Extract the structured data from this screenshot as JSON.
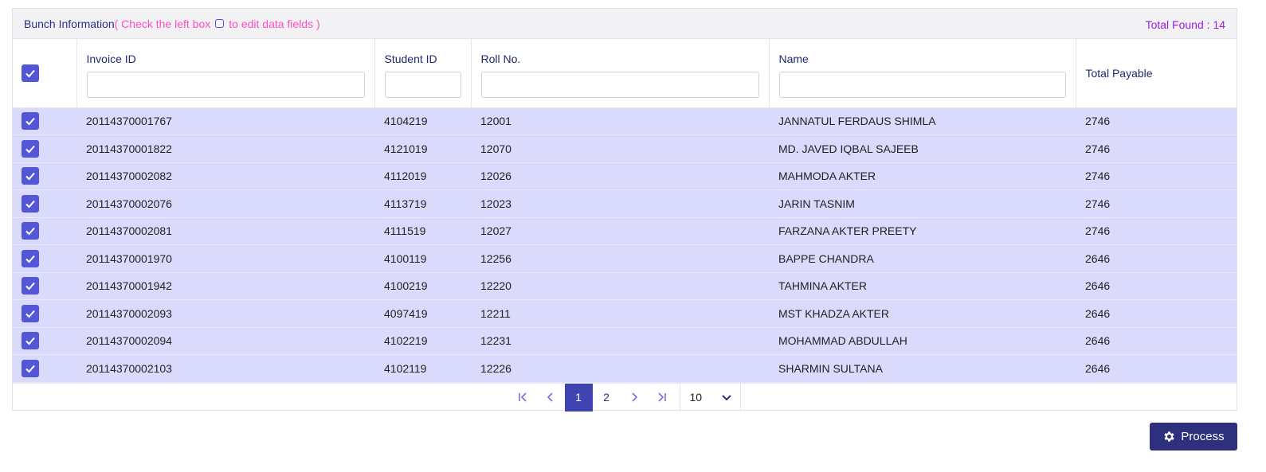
{
  "header": {
    "title": "Bunch Information",
    "hint_before": "( Check the left box",
    "hint_after": "to edit data fields )",
    "total_found": "Total Found : 14"
  },
  "columns": [
    "Invoice ID",
    "Student ID",
    "Roll No.",
    "Name",
    "Total Payable"
  ],
  "rows": [
    {
      "invoice_id": "20114370001767",
      "student_id": "4104219",
      "roll_no": "12001",
      "name": "JANNATUL FERDAUS SHIMLA",
      "total_payable": "2746",
      "checked": true
    },
    {
      "invoice_id": "20114370001822",
      "student_id": "4121019",
      "roll_no": "12070",
      "name": "MD. JAVED IQBAL SAJEEB",
      "total_payable": "2746",
      "checked": true
    },
    {
      "invoice_id": "20114370002082",
      "student_id": "4112019",
      "roll_no": "12026",
      "name": "MAHMODA AKTER",
      "total_payable": "2746",
      "checked": true
    },
    {
      "invoice_id": "20114370002076",
      "student_id": "4113719",
      "roll_no": "12023",
      "name": "JARIN TASNIM",
      "total_payable": "2746",
      "checked": true
    },
    {
      "invoice_id": "20114370002081",
      "student_id": "4111519",
      "roll_no": "12027",
      "name": "FARZANA AKTER PREETY",
      "total_payable": "2746",
      "checked": true
    },
    {
      "invoice_id": "20114370001970",
      "student_id": "4100119",
      "roll_no": "12256",
      "name": "BAPPE CHANDRA",
      "total_payable": "2646",
      "checked": true
    },
    {
      "invoice_id": "20114370001942",
      "student_id": "4100219",
      "roll_no": "12220",
      "name": "TAHMINA AKTER",
      "total_payable": "2646",
      "checked": true
    },
    {
      "invoice_id": "20114370002093",
      "student_id": "4097419",
      "roll_no": "12211",
      "name": "MST KHADZA AKTER",
      "total_payable": "2646",
      "checked": true
    },
    {
      "invoice_id": "20114370002094",
      "student_id": "4102219",
      "roll_no": "12231",
      "name": "MOHAMMAD ABDULLAH",
      "total_payable": "2646",
      "checked": true
    },
    {
      "invoice_id": "20114370002103",
      "student_id": "4102119",
      "roll_no": "12226",
      "name": "SHARMIN SULTANA",
      "total_payable": "2646",
      "checked": true
    }
  ],
  "pagination": {
    "pages": [
      "1",
      "2"
    ],
    "current_page": "1",
    "page_size": "10"
  },
  "actions": {
    "process_label": "Process"
  },
  "colors": {
    "accent": "#5356d6",
    "row_highlight": "#dadafc",
    "title": "#2b2f87",
    "hint": "#ff4fc3",
    "total_found": "#9b1fe0",
    "button": "#2e2f7d"
  },
  "icons": {
    "first_page": "first-page-icon",
    "prev_page": "prev-page-icon",
    "next_page": "next-page-icon",
    "last_page": "last-page-icon",
    "dropdown": "chevron-down-icon",
    "process": "gear-icon",
    "checkbox": "checkbox-checked-icon"
  }
}
